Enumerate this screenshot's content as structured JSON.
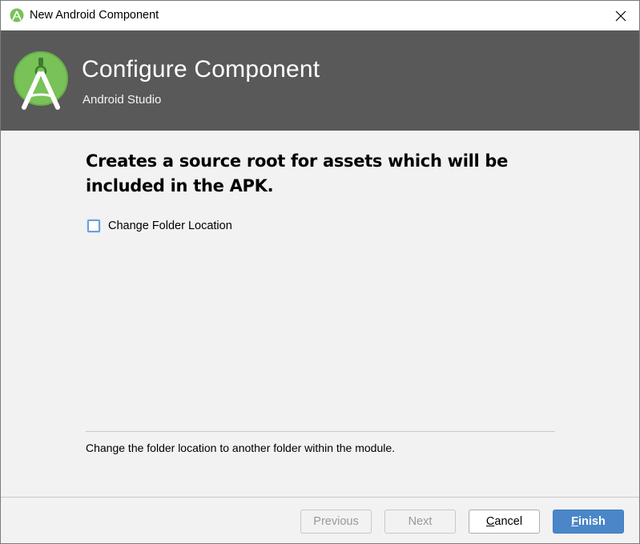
{
  "window": {
    "title": "New Android Component",
    "app_icon": "android-studio-icon",
    "close_icon": "close-icon"
  },
  "header": {
    "title": "Configure Component",
    "subtitle": "Android Studio",
    "logo": "android-studio-logo",
    "background": "#595959"
  },
  "main": {
    "description": "Creates a source root for assets which will be included in the APK.",
    "checkbox": {
      "label": "Change Folder Location",
      "checked": false
    },
    "help_text": "Change the folder location to another folder within the module."
  },
  "footer": {
    "previous_label": "Previous",
    "next_label": "Next",
    "cancel_mnemonic": "C",
    "cancel_rest": "ancel",
    "finish_mnemonic": "F",
    "finish_rest": "inish",
    "accent": "#4a86c8"
  }
}
